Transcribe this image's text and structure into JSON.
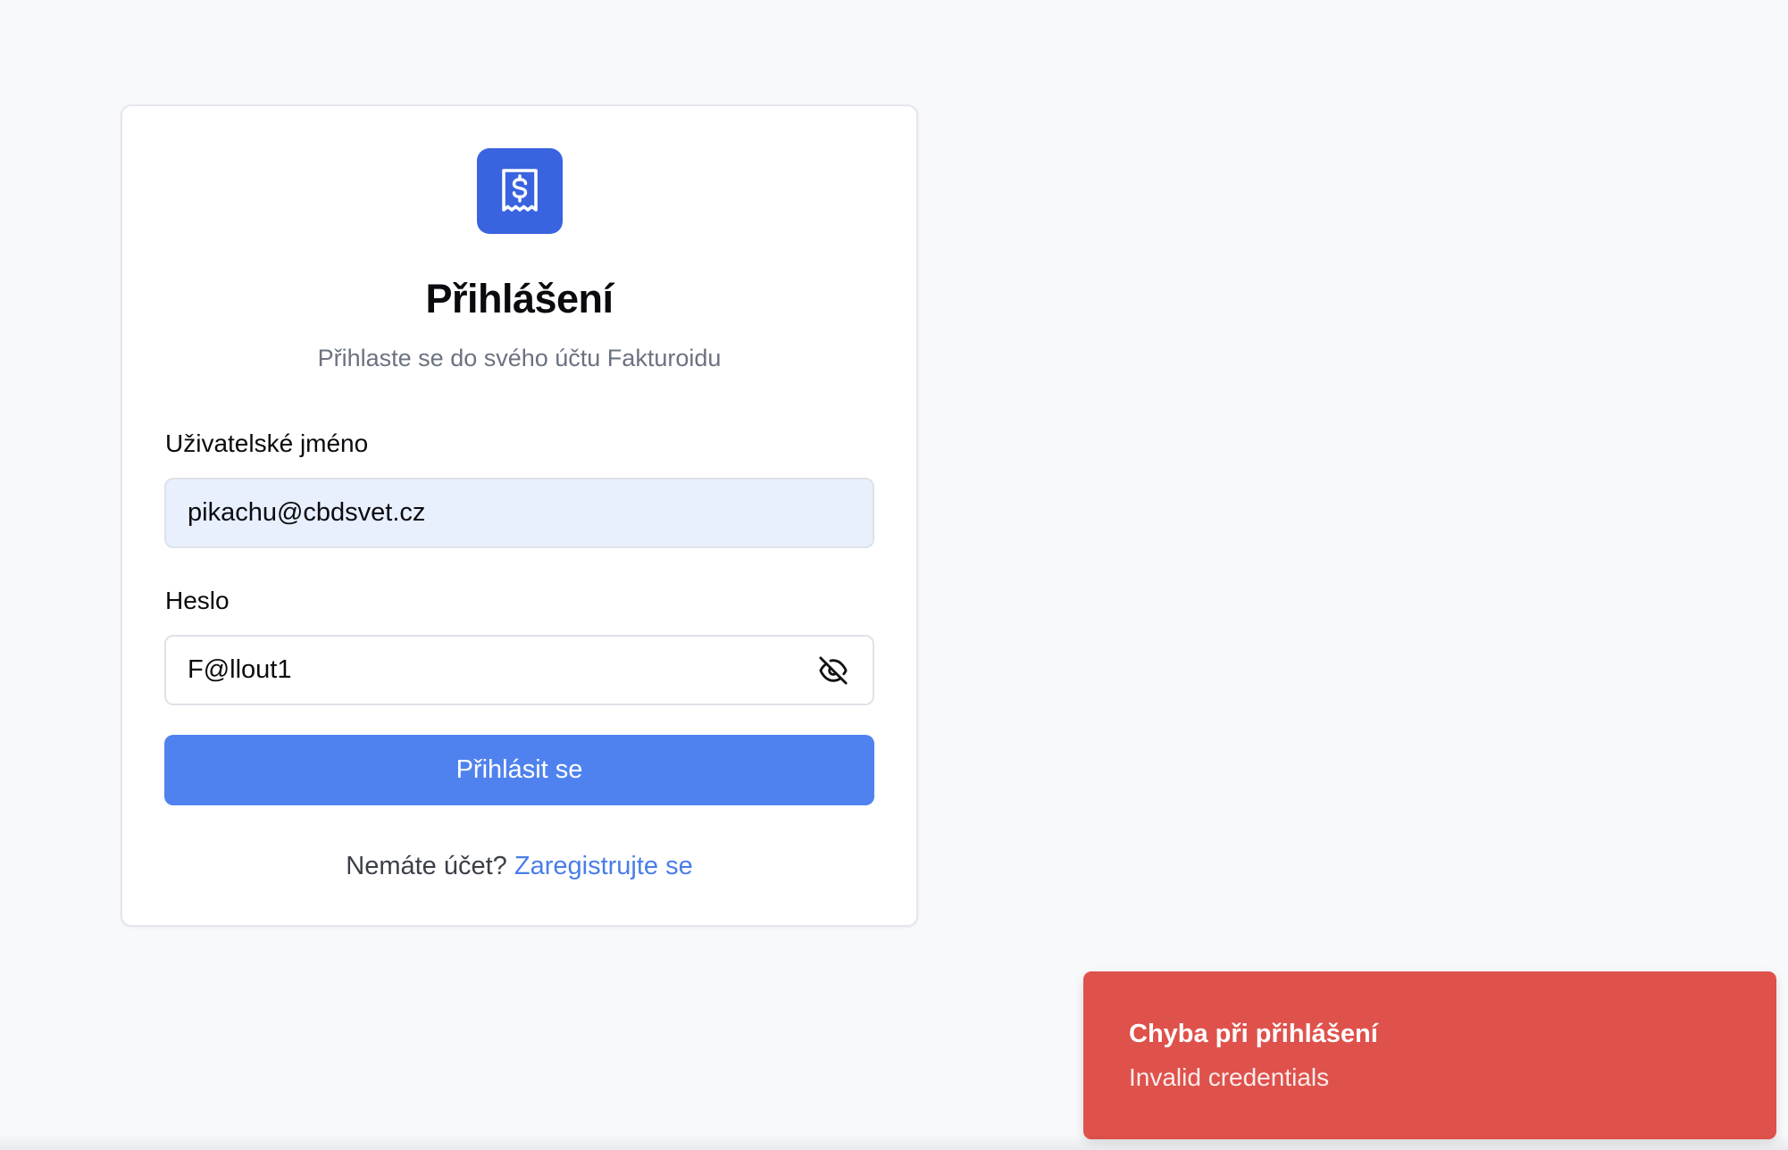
{
  "login": {
    "title": "Přihlášení",
    "subtitle": "Přihlaste se do svého účtu Fakturoidu",
    "username_label": "Uživatelské jméno",
    "username_value": "pikachu@cbdsvet.cz",
    "password_label": "Heslo",
    "password_value": "F@llout1",
    "submit_label": "Přihlásit se",
    "no_account_text": "Nemáte účet?",
    "register_link": "Zaregistrujte se",
    "logo_icon": "receipt-dollar-icon",
    "password_toggle_icon": "eye-off-icon"
  },
  "toast": {
    "title": "Chyba při přihlášení",
    "message": "Invalid credentials"
  },
  "colors": {
    "accent": "#3a63e0",
    "button": "#4f82ef",
    "link": "#4a7de9",
    "error": "#df514b",
    "autofill_bg": "#e8effd",
    "page_bg": "#f8f9fb"
  }
}
